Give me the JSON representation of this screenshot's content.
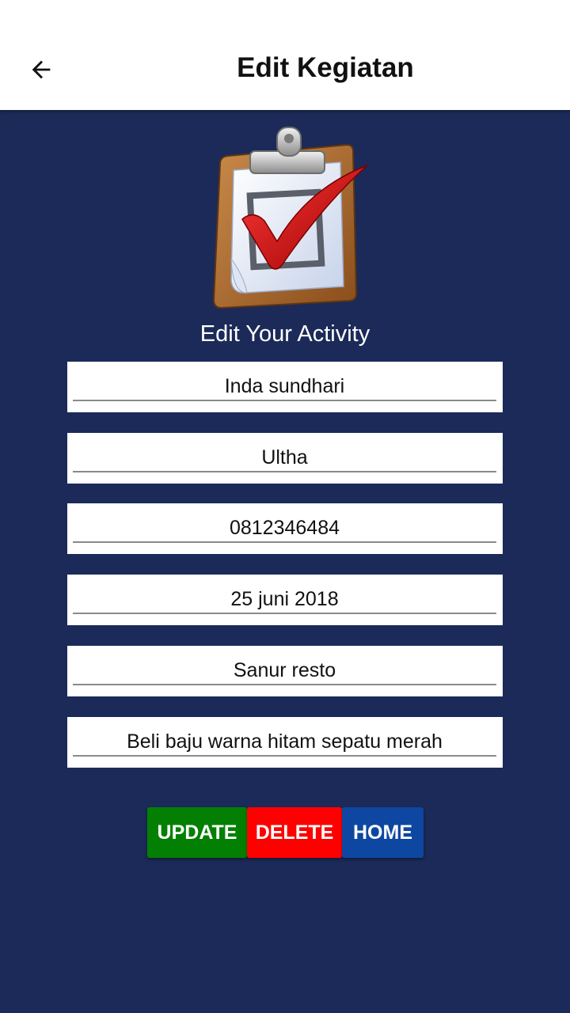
{
  "appbar": {
    "title": "Edit Kegiatan",
    "back_icon": "arrow-left-icon"
  },
  "main": {
    "logo_icon": "clipboard-checkmark-icon",
    "subtitle": "Edit Your Activity",
    "fields": [
      {
        "value": "Inda sundhari"
      },
      {
        "value": "Ultha"
      },
      {
        "value": "0812346484"
      },
      {
        "value": "25 juni 2018"
      },
      {
        "value": "Sanur resto"
      },
      {
        "value": "Beli baju warna hitam sepatu merah"
      }
    ],
    "buttons": {
      "update": "UPDATE",
      "delete": "DELETE",
      "home": "HOME"
    }
  },
  "colors": {
    "background": "#1b2a58",
    "update": "#038003",
    "delete": "#ff0000",
    "home": "#0d47a1"
  }
}
